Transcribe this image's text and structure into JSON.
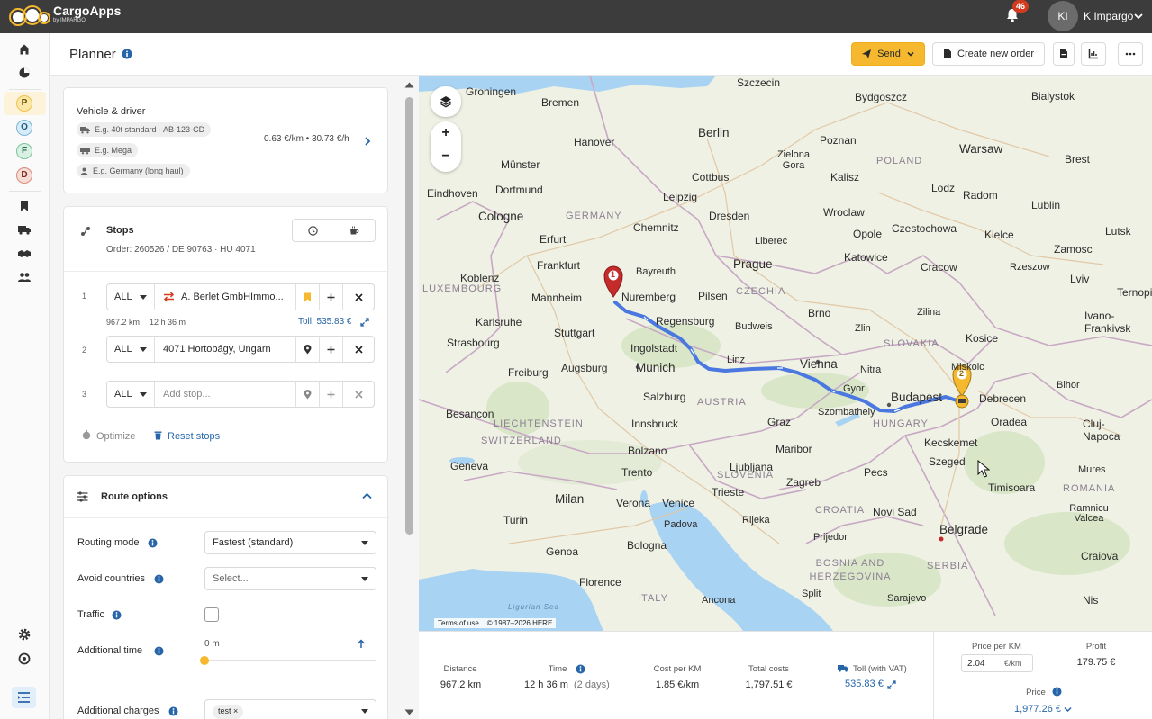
{
  "app": {
    "name": "CargoApps",
    "sub": "by IMPARGO",
    "notifications": "46",
    "user_initials": "KI",
    "user_name": "K Impargo"
  },
  "header": {
    "title": "Planner",
    "send_label": "Send",
    "create_order_label": "Create new order"
  },
  "nav": {
    "letters": [
      "P",
      "O",
      "F",
      "D"
    ]
  },
  "vehicle": {
    "title": "Vehicle & driver",
    "truck_placeholder": "E.g. 40t standard - AB-123-CD",
    "trailer_placeholder": "E.g. Mega",
    "driver_placeholder": "E.g. Germany (long haul)",
    "cost_summary": "0.63 €/km • 30.73 €/h"
  },
  "stops": {
    "title": "Stops",
    "order_info": "Order: 260526 / DE 90763 · HU 4071",
    "items": [
      {
        "num": "1",
        "filter": "ALL",
        "text": "A. Berlet GmbHImmo..."
      },
      {
        "num": "2",
        "filter": "ALL",
        "text": "4071 Hortobágy, Ungarn"
      },
      {
        "num": "3",
        "filter": "ALL",
        "placeholder": "Add stop..."
      }
    ],
    "leg_distance": "967.2 km",
    "leg_time": "12 h 36 m",
    "toll": "Toll: 535.83 €",
    "optimize_label": "Optimize",
    "reset_label": "Reset stops"
  },
  "route_options": {
    "title": "Route options",
    "routing_mode_label": "Routing mode",
    "routing_mode_value": "Fastest (standard)",
    "avoid_label": "Avoid countries",
    "avoid_placeholder": "Select...",
    "traffic_label": "Traffic",
    "additional_time_label": "Additional time",
    "additional_time_value": "0 m",
    "additional_charges_label": "Additional charges",
    "charge_tag": "test"
  },
  "map": {
    "cities": [
      "Groningen",
      "Bremen",
      "Szczecin",
      "Bydgoszcz",
      "Bialystok",
      "Hanover",
      "Berlin",
      "Poznan",
      "Warsaw",
      "Münster",
      "Cottbus",
      "Zielona Gora",
      "Kalisz",
      "Brest",
      "Eindhoven",
      "Dortmund",
      "Leipzig",
      "Lodz",
      "Radom",
      "Cologne",
      "Dresden",
      "Wroclaw",
      "Czestochowa",
      "Lublin",
      "Lutsk",
      "Chemnitz",
      "Opole",
      "Kielce",
      "Erfurt",
      "Liberec",
      "Katowice",
      "Zamosc",
      "Koblenz",
      "Frankfurt",
      "Prague",
      "Cracow",
      "Rzeszow",
      "Lviv",
      "Ternopil",
      "Bayreuth",
      "Nuremberg",
      "Mannheim",
      "Pilsen",
      "Brno",
      "Ivano-Frankivsk",
      "Karlsruhe",
      "Regensburg",
      "Budweis",
      "Zlin",
      "Zilina",
      "Stuttgart",
      "Ingolstadt",
      "Kosice",
      "Strasbourg",
      "Linz",
      "Vienna",
      "Miskolc",
      "Freiburg",
      "Augsburg",
      "Munich",
      "Nitra",
      "Budapest",
      "Debrecen",
      "Bihor",
      "Salzburg",
      "Gyor",
      "Oradea",
      "Cluj-Napoca",
      "Besancon",
      "Innsbruck",
      "Graz",
      "Szombathely",
      "Kecskemet",
      "Bolzano",
      "Maribor",
      "Szeged",
      "Mures",
      "Geneva",
      "Trento",
      "Ljubljana",
      "Pecs",
      "Timisoara",
      "Zagreb",
      "Milan",
      "Verona",
      "Venice",
      "Trieste",
      "Novi Sad",
      "Ramnicu Valcea",
      "Turin",
      "Padova",
      "Rijeka",
      "Belgrade",
      "Bologna",
      "Prijedor",
      "Genoa",
      "Craiova",
      "Florence",
      "Split",
      "Sarajevo",
      "Nis",
      "Ancona"
    ],
    "countries": [
      "POLAND",
      "GERMANY",
      "CZECHIA",
      "SLOVAKIA",
      "AUSTRIA",
      "HUNGARY",
      "LIECHTENSTEIN",
      "SWITZERLAND",
      "SLOVENIA",
      "CROATIA",
      "ROMANIA",
      "BOSNIA AND HERZEGOVINA",
      "SERBIA",
      "ITALY",
      "LUXEMBOURG"
    ],
    "sea": "Ligurian Sea",
    "terms": "Terms of use",
    "copyright": "© 1987–2026 HERE",
    "marker_1": "1",
    "marker_2": "2",
    "zoom_in": "+",
    "zoom_out": "−",
    "route_color": "#4a78e0"
  },
  "summary": {
    "distance_label": "Distance",
    "distance": "967.2 km",
    "time_label": "Time",
    "time": "12 h 36 m",
    "time_days": "(2 days)",
    "cost_km_label": "Cost per KM",
    "cost_km": "1.85 €/km",
    "total_costs_label": "Total costs",
    "total_costs": "1,797.51 €",
    "toll_label": "Toll (with VAT)",
    "toll": "535.83 €",
    "price_km_label": "Price per KM",
    "price_km_value": "2.04",
    "price_km_unit": "€/km",
    "profit_label": "Profit",
    "profit": "179.75 €",
    "price_label": "Price",
    "price": "1,977.26 €"
  }
}
